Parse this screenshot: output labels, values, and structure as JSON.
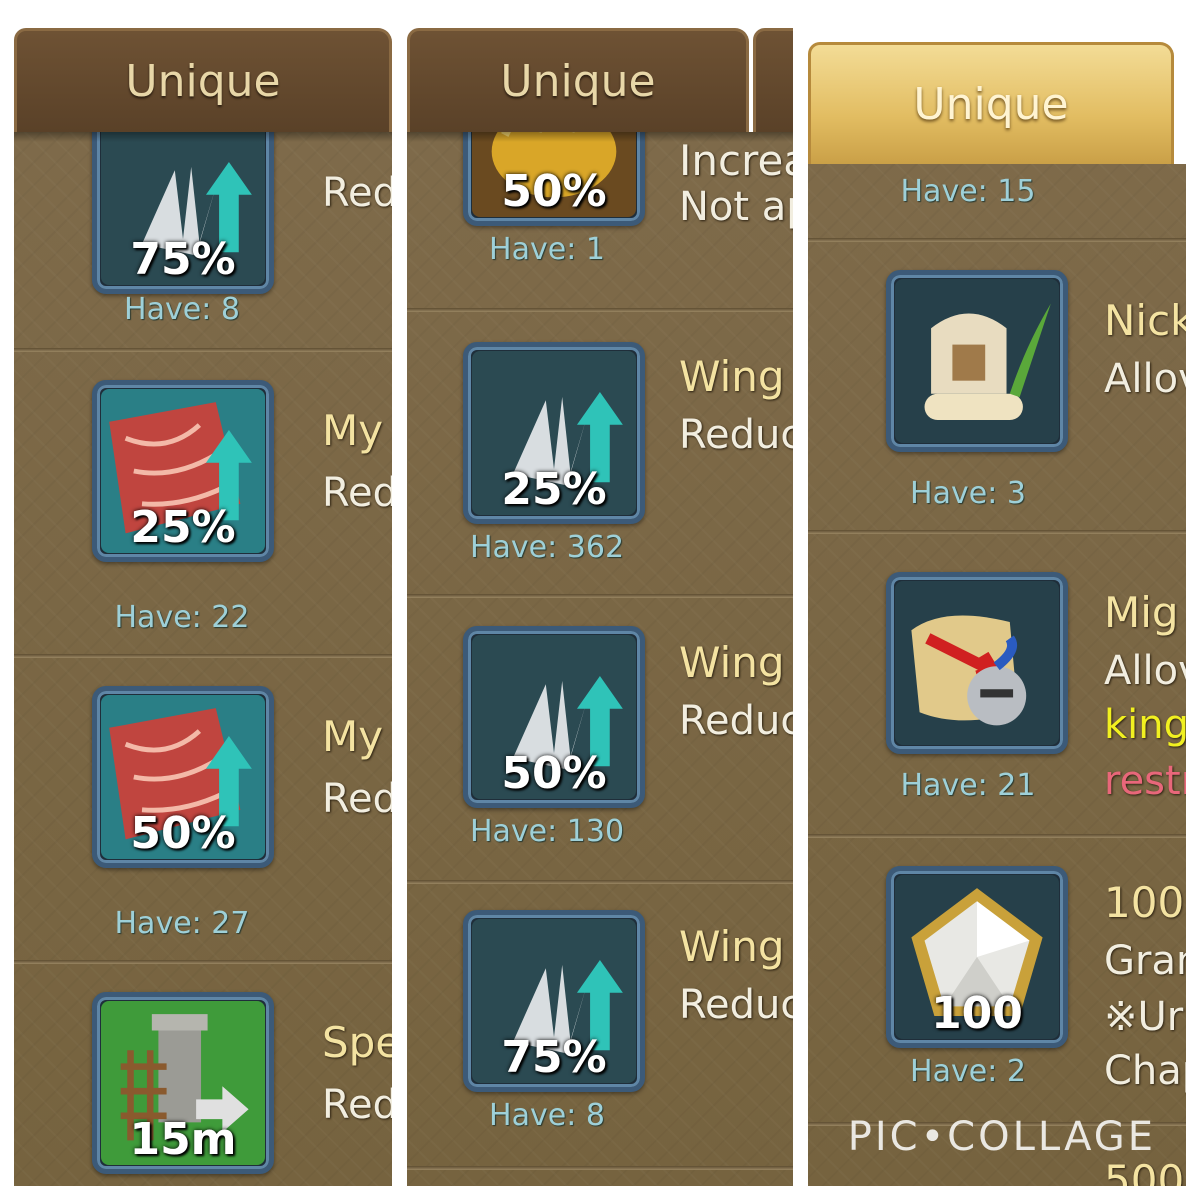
{
  "colors": {
    "panel_bg": "#7b6848",
    "have_text": "#9ed0d8",
    "name_text": "#f4e3a2",
    "desc_text": "#f2eee0",
    "active_tab": "#e2bd62"
  },
  "panel1": {
    "tab": "Unique",
    "items": [
      {
        "icon": "wing-speedup-icon",
        "label": "75%",
        "have": "Have: 8",
        "name": "",
        "desc": "Red"
      },
      {
        "icon": "carpet-speedup-icon",
        "label": "25%",
        "have": "Have: 22",
        "name": "My",
        "desc": "Red"
      },
      {
        "icon": "carpet-speedup-icon",
        "label": "50%",
        "have": "Have: 27",
        "name": "My",
        "desc": "Red"
      },
      {
        "icon": "construction-speedup-icon",
        "label": "15m",
        "have": "",
        "name": "Spe",
        "desc": "Red"
      }
    ]
  },
  "panel2": {
    "tab": "Unique",
    "items": [
      {
        "icon": "wheat-icon",
        "label": "50%",
        "have": "Have: 1",
        "name": "Increa",
        "desc": "Not ap"
      },
      {
        "icon": "wing-speedup-icon",
        "label": "25%",
        "have": "Have: 362",
        "name": "Wing",
        "desc": "Reduc"
      },
      {
        "icon": "wing-speedup-icon",
        "label": "50%",
        "have": "Have: 130",
        "name": "Wing",
        "desc": "Reduc"
      },
      {
        "icon": "wing-speedup-icon",
        "label": "75%",
        "have": "Have: 8",
        "name": "Wing",
        "desc": "Reduc"
      }
    ]
  },
  "panel3": {
    "tab": "Unique",
    "top_have": "Have: 15",
    "items": [
      {
        "icon": "helmet-quill-icon",
        "label": "",
        "have": "Have: 3",
        "name": "Nick",
        "desc": "Allov"
      },
      {
        "icon": "scroll-knight-icon",
        "label": "",
        "have": "Have: 21",
        "name": "Mig",
        "desc": "Allov",
        "extra1": "king",
        "extra2": "restr"
      },
      {
        "icon": "gem-star-icon",
        "label": "100",
        "have": "Have: 2",
        "name": "100",
        "desc": "Gran",
        "extra1": "※Ur",
        "extra2": "Chap"
      },
      {
        "icon": "",
        "label": "",
        "have": "",
        "name": "500",
        "desc": ""
      }
    ]
  },
  "watermark": "PIC•COLLAGE"
}
